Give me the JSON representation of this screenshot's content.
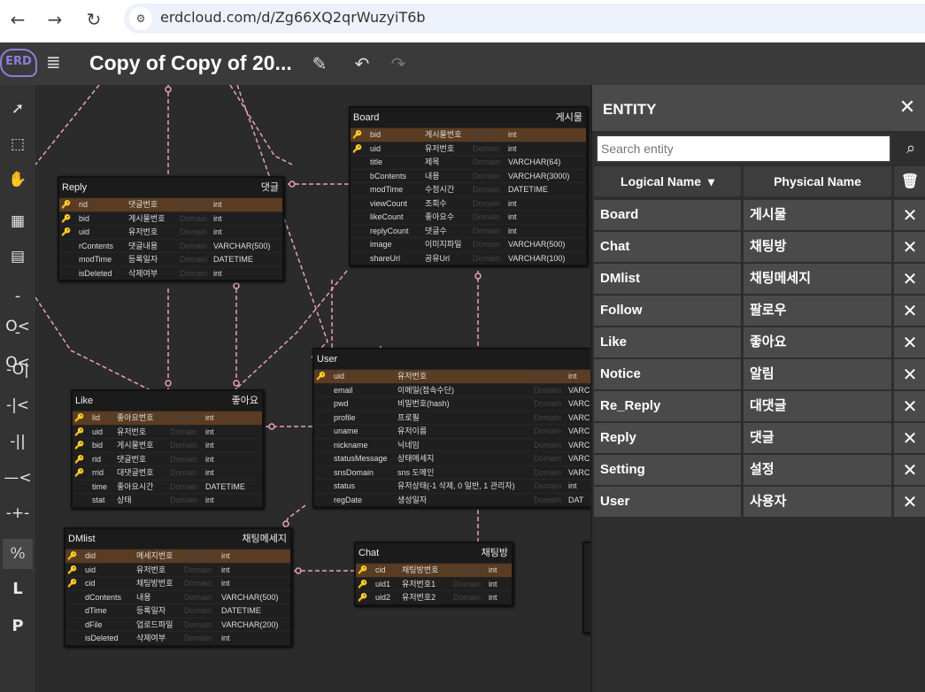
{
  "browser": {
    "url": "erdcloud.com/d/Zg66XQ2qrWuzyiT6b",
    "back_icon": "←",
    "forward_icon": "→",
    "reload_icon": "↻",
    "site_icon": "⚙"
  },
  "app": {
    "logo": "ERD",
    "title": "Copy of Copy of 20...",
    "edit_icon": "✎",
    "undo_icon": "↶",
    "redo_icon": "↷"
  },
  "tools": [
    {
      "name": "select-tool",
      "glyph": "➚"
    },
    {
      "name": "marquee-tool",
      "glyph": "⬚"
    },
    {
      "name": "hand-tool",
      "glyph": "✋"
    },
    {
      "name": "table-tool",
      "glyph": "▦"
    },
    {
      "name": "note-tool",
      "glyph": "▤"
    },
    {
      "name": "rel-one-to-zero-many-tool",
      "glyph": "-O<"
    },
    {
      "name": "rel-zero-many-tool",
      "glyph": "-O<"
    },
    {
      "name": "rel-zero-one-tool",
      "glyph": "-O|"
    },
    {
      "name": "rel-one-many-tool",
      "glyph": "-|<"
    },
    {
      "name": "rel-one-one-tool",
      "glyph": "-||"
    },
    {
      "name": "rel-many-tool",
      "glyph": "—<"
    },
    {
      "name": "rel-line-tool",
      "glyph": "-+-"
    },
    {
      "name": "logical-physical-toggle",
      "glyph": "⁰⁄₀"
    },
    {
      "name": "logical-view-button",
      "glyph": "L"
    },
    {
      "name": "physical-view-button",
      "glyph": "P"
    }
  ],
  "panel": {
    "title": "ENTITY",
    "close_icon": "✕",
    "search_placeholder": "Search entity",
    "search_icon": "⌕",
    "col_logical": "Logical Name",
    "col_physical": "Physical Name",
    "sort_icon": "▾",
    "trash_icon": "🗑",
    "entities": [
      {
        "logical": "Board",
        "physical": "게시물"
      },
      {
        "logical": "Chat",
        "physical": "채팅방"
      },
      {
        "logical": "DMlist",
        "physical": "채팅메세지"
      },
      {
        "logical": "Follow",
        "physical": "팔로우"
      },
      {
        "logical": "Like",
        "physical": "좋아요"
      },
      {
        "logical": "Notice",
        "physical": "알림"
      },
      {
        "logical": "Re_Reply",
        "physical": "대댓글"
      },
      {
        "logical": "Reply",
        "physical": "댓글"
      },
      {
        "logical": "Setting",
        "physical": "설정"
      },
      {
        "logical": "User",
        "physical": "사용자"
      }
    ]
  },
  "diagram": {
    "key_icon": "🔑",
    "domain_text": "Domain",
    "tables": [
      {
        "id": "board",
        "logical": "Board",
        "physical": "게시물",
        "rows": [
          [
            "pk",
            "bid",
            "게시물번호",
            "int"
          ],
          [
            "fk",
            "uid",
            "유저번호",
            "int"
          ],
          [
            "",
            "title",
            "제목",
            "VARCHAR(64)"
          ],
          [
            "",
            "bContents",
            "내용",
            "VARCHAR(3000)"
          ],
          [
            "",
            "modTime",
            "수정시간",
            "DATETIME"
          ],
          [
            "",
            "viewCount",
            "조회수",
            "int"
          ],
          [
            "",
            "likeCount",
            "좋아요수",
            "int"
          ],
          [
            "",
            "replyCount",
            "댓글수",
            "int"
          ],
          [
            "",
            "image",
            "이미지파일",
            "VARCHAR(500)"
          ],
          [
            "",
            "shareUrl",
            "공유Url",
            "VARCHAR(100)"
          ]
        ]
      },
      {
        "id": "reply",
        "logical": "Reply",
        "physical": "댓글",
        "rows": [
          [
            "pk",
            "rid",
            "댓글번호",
            "int"
          ],
          [
            "fk",
            "bid",
            "게시물번호",
            "int"
          ],
          [
            "fk",
            "uid",
            "유저번호",
            "int"
          ],
          [
            "",
            "rContents",
            "댓글내용",
            "VARCHAR(500)"
          ],
          [
            "",
            "modTime",
            "등록일자",
            "DATETIME"
          ],
          [
            "",
            "isDeleted",
            "삭제여부",
            "int"
          ]
        ]
      },
      {
        "id": "user",
        "logical": "User",
        "physical": "",
        "rows": [
          [
            "pk",
            "uid",
            "유저번호",
            "int"
          ],
          [
            "",
            "email",
            "이메일(접속수단)",
            "VARC"
          ],
          [
            "",
            "pwd",
            "비밀번호(hash)",
            "VARC"
          ],
          [
            "",
            "profile",
            "프로필",
            "VARC"
          ],
          [
            "",
            "uname",
            "유저이름",
            "VARC"
          ],
          [
            "",
            "nickname",
            "닉네임",
            "VARC"
          ],
          [
            "",
            "statusMessage",
            "상태메세지",
            "VARC"
          ],
          [
            "",
            "snsDomain",
            "sns 도메인",
            "VARC"
          ],
          [
            "",
            "status",
            "유저상태(-1 삭제, 0 일반, 1 관리자)",
            "int"
          ],
          [
            "",
            "regDate",
            "생성일자",
            "DAT"
          ]
        ]
      },
      {
        "id": "like",
        "logical": "Like",
        "physical": "좋아요",
        "rows": [
          [
            "pk",
            "lid",
            "좋아요번호",
            "int"
          ],
          [
            "fk",
            "uid",
            "유저번호",
            "int"
          ],
          [
            "fk",
            "bid",
            "게시물번호",
            "int"
          ],
          [
            "fk",
            "rid",
            "댓글번호",
            "int"
          ],
          [
            "fk",
            "rrid",
            "대댓글번호",
            "int"
          ],
          [
            "",
            "time",
            "좋아요시간",
            "DATETIME"
          ],
          [
            "",
            "stat",
            "상태",
            "int"
          ]
        ]
      },
      {
        "id": "dmlist",
        "logical": "DMlist",
        "physical": "채팅메세지",
        "rows": [
          [
            "pk",
            "did",
            "메세지번호",
            "int"
          ],
          [
            "fk",
            "uid",
            "유저번호",
            "int"
          ],
          [
            "fk",
            "cid",
            "채팅방번호",
            "int"
          ],
          [
            "",
            "dContents",
            "내용",
            "VARCHAR(500)"
          ],
          [
            "",
            "dTime",
            "등록일자",
            "DATETIME"
          ],
          [
            "",
            "dFile",
            "업로드파일",
            "VARCHAR(200)"
          ],
          [
            "",
            "isDeleted",
            "삭제여부",
            "int"
          ]
        ]
      },
      {
        "id": "chat",
        "logical": "Chat",
        "physical": "채팅방",
        "rows": [
          [
            "pk",
            "cid",
            "채팅방번호",
            "int"
          ],
          [
            "fk",
            "uid1",
            "유저번호1",
            "int"
          ],
          [
            "fk",
            "uid2",
            "유저번호2",
            "int"
          ]
        ]
      }
    ]
  }
}
